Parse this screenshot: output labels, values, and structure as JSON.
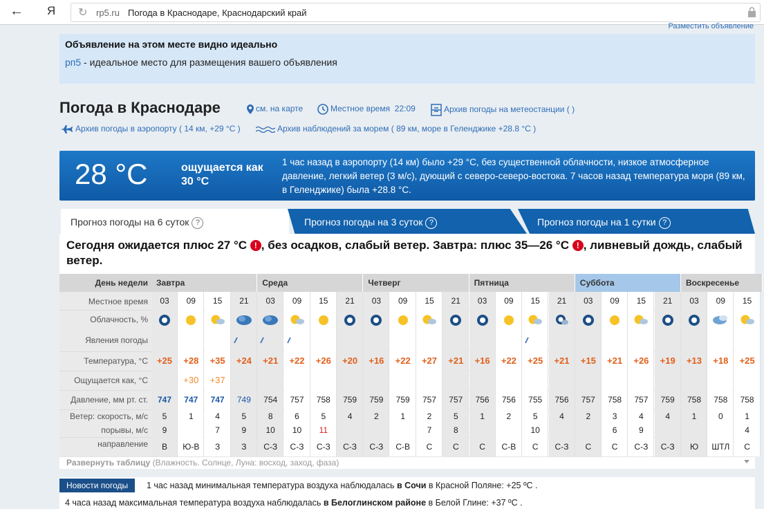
{
  "browser": {
    "back": "←",
    "logo": "Я",
    "reload": "↻",
    "domain": "rp5.ru",
    "title": "Погода в Краснодаре, Краснодарский край"
  },
  "ad": {
    "link": "Разместить объявление",
    "title": "Объявление на этом месте видно идеально",
    "brand": "рп5",
    "text": " - идеальное место для размещения вашего объявления"
  },
  "header": {
    "title": "Погода в Краснодаре",
    "map": "см. на карте",
    "time_label": "Местное время",
    "time_value": "22:09",
    "archive_station": "Архив погоды на метеостанции ( )",
    "archive_airport": "Архив погоды в аэропорту ( 14 км, +29 °C )",
    "archive_sea": "Архив наблюдений за морем ( 89 км, море в Геленджике +28.8 °C )"
  },
  "now": {
    "temp": "28 °C",
    "feels": "ощущается как 30 °C",
    "desc": "1 час назад в аэропорту (14 км) было +29 °C, без существенной облачности, низкое атмосферное давление, легкий ветер (3 м/с), дующий с северо-северо-востока. 7 часов назад температура моря (89 км, в Геленджике) была +28.8 °C."
  },
  "tabs": [
    "Прогноз погоды на 6 суток",
    "Прогноз погоды на 3 суток",
    "Прогноз погоды на 1 сутки"
  ],
  "summary": {
    "p1": "Сегодня ожидается плюс 27 °C ",
    "p2": ", без осадков, слабый ветер. Завтра: плюс 35—26 °C ",
    "p3": ", ливневый дождь, слабый ветер.",
    "warn": "!"
  },
  "rows": {
    "day": "День недели",
    "time": "Местное время",
    "cloud": "Облачность, %",
    "phen": "Явления погоды",
    "temp": "Температура, °C",
    "feel": "Ощущается как, °C",
    "press": "Давление, мм рт. ст.",
    "wind": "Ветер: скорость, м/с",
    "gust": "порывы, м/с",
    "dir": "направление"
  },
  "days": [
    "Завтра",
    "Среда",
    "Четверг",
    "Пятница",
    "Суббота",
    "Воскресенье"
  ],
  "hours": [
    "03",
    "09",
    "15",
    "21",
    "03",
    "09",
    "15",
    "21",
    "03",
    "09",
    "15",
    "21",
    "03",
    "09",
    "15",
    "21",
    "03",
    "09",
    "15",
    "21",
    "03",
    "09",
    "15"
  ],
  "icons": [
    "moon",
    "sun",
    "sunc",
    "storm",
    "storm",
    "sunc",
    "sun",
    "moon",
    "moon",
    "sun",
    "sunc",
    "moon",
    "moon",
    "sun",
    "sunc",
    "moonc",
    "moon",
    "sun",
    "sunc",
    "moon",
    "moon",
    "cloud",
    "sunc"
  ],
  "rain": [
    0,
    0,
    0,
    1,
    1,
    1,
    0,
    0,
    0,
    0,
    0,
    0,
    0,
    0,
    1,
    0,
    0,
    0,
    0,
    0,
    0,
    0,
    0
  ],
  "temps": [
    "+25",
    "+28",
    "+35",
    "+24",
    "+21",
    "+22",
    "+26",
    "+20",
    "+16",
    "+22",
    "+27",
    "+21",
    "+16",
    "+22",
    "+25",
    "+21",
    "+15",
    "+21",
    "+26",
    "+19",
    "+13",
    "+18",
    "+25"
  ],
  "feels": [
    "",
    "+30",
    "+37",
    "",
    "",
    "",
    "",
    "",
    "",
    "",
    "",
    "",
    "",
    "",
    "",
    "",
    "",
    "",
    "",
    "",
    "",
    "",
    ""
  ],
  "press": [
    "747",
    "747",
    "747",
    "749",
    "754",
    "757",
    "758",
    "759",
    "759",
    "759",
    "757",
    "757",
    "756",
    "756",
    "755",
    "756",
    "757",
    "758",
    "757",
    "759",
    "758",
    "758",
    "758"
  ],
  "wind": [
    "5",
    "1",
    "4",
    "5",
    "8",
    "6",
    "5",
    "4",
    "2",
    "1",
    "2",
    "5",
    "1",
    "2",
    "5",
    "4",
    "2",
    "3",
    "4",
    "4",
    "1",
    "0",
    "1"
  ],
  "gust": [
    "9",
    "",
    "7",
    "9",
    "10",
    "10",
    "11",
    "",
    "",
    "",
    "7",
    "8",
    "",
    "",
    "10",
    "",
    "",
    "6",
    "9",
    "",
    "",
    "",
    "4"
  ],
  "gust_red": [
    0,
    0,
    0,
    0,
    0,
    0,
    1,
    0,
    0,
    0,
    0,
    0,
    0,
    0,
    0,
    0,
    0,
    0,
    0,
    0,
    0,
    0,
    0
  ],
  "dir": [
    "В",
    "Ю-В",
    "З",
    "З",
    "С-З",
    "С-З",
    "С-З",
    "С-З",
    "С-З",
    "С-В",
    "С",
    "С",
    "С",
    "С-В",
    "С",
    "С-З",
    "С",
    "С",
    "С-З",
    "С-З",
    "Ю",
    "ШТЛ",
    "С"
  ],
  "expand": {
    "bold": "Развернуть таблицу",
    "rest": " (Влажность. Солнце, Луна: восход, заход, фаза)"
  },
  "news": {
    "tag": "Новости погоды",
    "l1_pre": "1 час назад минимальная температура воздуха наблюдалась ",
    "l1_b": "в Сочи",
    "l1_post": " в Красной Поляне: +25 ºC .",
    "l2_pre": "4 часа назад максимальная температура воздуха наблюдалась ",
    "l2_b": "в Белоглинском районе",
    "l2_post": " в Белой Глине: +37 ºC ."
  },
  "colors": {
    "accent": "#1262ad",
    "temp": "#e2601b",
    "link": "#2f6db5"
  }
}
